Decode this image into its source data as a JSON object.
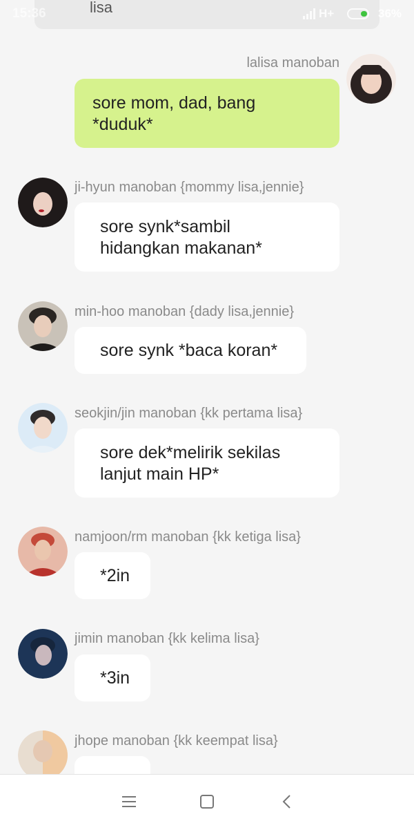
{
  "status_bar": {
    "time": "15:36",
    "network": "H+",
    "battery": "36%"
  },
  "header": {
    "title": "lisa"
  },
  "messages": [
    {
      "sender": "lalisa manoban",
      "text": "sore mom, dad, bang\n*duduk*",
      "outgoing": true,
      "avatar_color": "#2b2221"
    },
    {
      "sender": "ji-hyun manoban {mommy lisa,jennie}",
      "text": "sore synk*sambil\nhidangkan makanan*",
      "outgoing": false,
      "avatar_color": "#1f1a1a"
    },
    {
      "sender": "min-hoo manoban {dady lisa,jennie}",
      "text": "sore synk *baca koran*",
      "outgoing": false,
      "avatar_color": "#2a2623"
    },
    {
      "sender": "seokjin/jin manoban {kk pertama lisa}",
      "text": "sore dek*melirik sekilas\nlanjut main HP*",
      "outgoing": false,
      "avatar_color": "#cfe3f2"
    },
    {
      "sender": "namjoon/rm manoban {kk ketiga lisa}",
      "text": "*2in",
      "outgoing": false,
      "avatar_color": "#b8322c"
    },
    {
      "sender": "jimin manoban {kk kelima lisa}",
      "text": "*3in",
      "outgoing": false,
      "avatar_color": "#1d3557"
    },
    {
      "sender": "jhope manoban {kk keempat lisa}",
      "text": "",
      "outgoing": false,
      "avatar_color": "#d9c7a8"
    }
  ],
  "colors": {
    "background": "#f5f5f5",
    "outgoing_bubble": "#d6f28d",
    "incoming_bubble": "#ffffff",
    "sender_text": "#8a8a8a"
  },
  "nav": {
    "menu_icon": "menu-icon",
    "home_icon": "home-square-icon",
    "back_icon": "back-chevron-icon"
  }
}
